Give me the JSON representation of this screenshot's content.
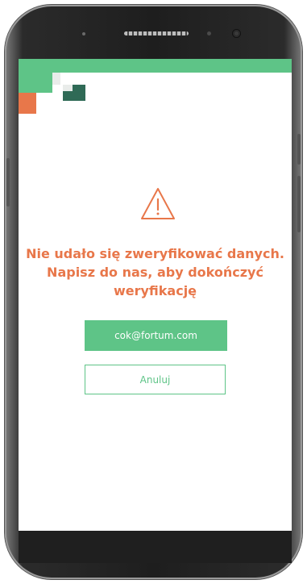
{
  "screen": {
    "message_lines": [
      "Nie udało się zweryfikować danych.",
      "Napisz do nas, aby dokończyć",
      "weryfikację"
    ],
    "primary_button_label": "cok@fortum.com",
    "secondary_button_label": "Anuluj",
    "icons": {
      "warning": "warning-triangle-icon"
    }
  },
  "colors": {
    "brand_green": "#5ec487",
    "brand_dark_green": "#2f6a56",
    "accent_orange": "#e8774a",
    "background": "#ffffff"
  }
}
